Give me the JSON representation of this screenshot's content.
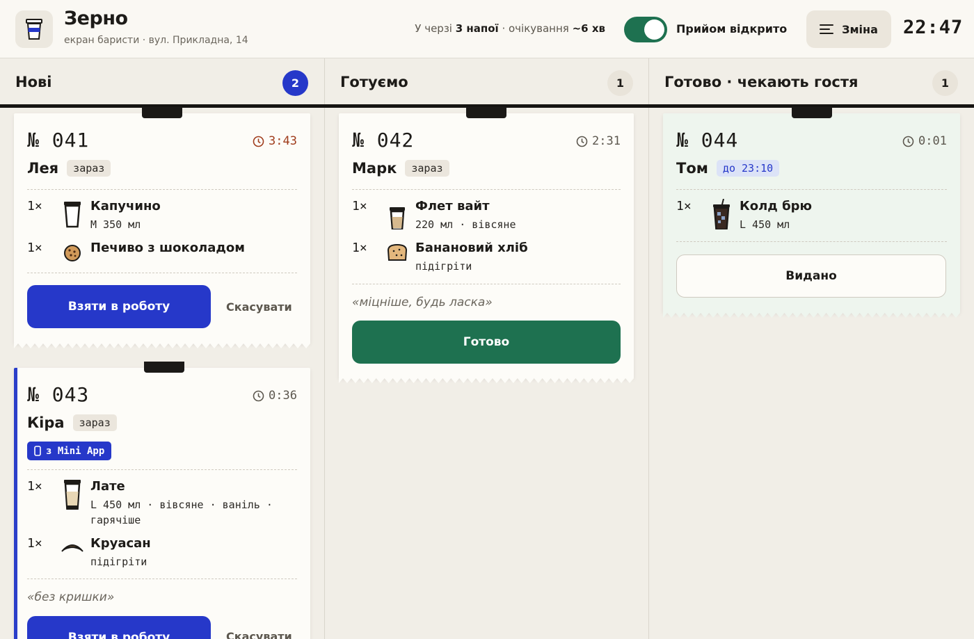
{
  "header": {
    "brand": "Зерно",
    "subtitle": "екран баристи · вул. Прикладна, 14",
    "queue_prefix": "У черзі ",
    "queue_count": "3 напої",
    "queue_mid": " · очікування ",
    "queue_wait": "~6 хв",
    "toggle_label": "Прийом відкрито",
    "toggle_on": true,
    "shift_label": "Зміна",
    "clock": "22:47"
  },
  "colors": {
    "accent": "#2638c9",
    "ready": "#1e7150",
    "warn": "#a03d1d",
    "ink": "#161412"
  },
  "columns": [
    {
      "title": "Нові",
      "count": "2"
    },
    {
      "title": "Готуємо",
      "count": "1"
    },
    {
      "title": "Готово · чекають гостя",
      "count": "1"
    }
  ],
  "tickets": {
    "t041": {
      "number": "№ 041",
      "timer": "3:43",
      "customer": "Лея",
      "chip": "зараз",
      "items": [
        {
          "qty": "1×",
          "icon": "cup-icon",
          "name": "Капучино",
          "opts": "M 350 мл"
        },
        {
          "qty": "1×",
          "icon": "cookie-icon",
          "name": "Печиво з шоколадом",
          "opts": ""
        }
      ],
      "primary": "Взяти в роботу",
      "cancel": "Скасувати"
    },
    "t043": {
      "number": "№ 043",
      "timer": "0:36",
      "customer": "Кіра",
      "chip": "зараз",
      "source": "з Mini App",
      "items": [
        {
          "qty": "1×",
          "icon": "tall-cup-icon",
          "name": "Лате",
          "opts": "L 450 мл · вівсяне · ваніль · гарячіше"
        },
        {
          "qty": "1×",
          "icon": "croissant-icon",
          "name": "Круасан",
          "opts": "підігріти"
        }
      ],
      "note": "«без кришки»",
      "primary": "Взяти в роботу",
      "cancel": "Скасувати"
    },
    "t042": {
      "number": "№ 042",
      "timer": "2:31",
      "customer": "Марк",
      "chip": "зараз",
      "items": [
        {
          "qty": "1×",
          "icon": "cup-icon",
          "name": "Флет вайт",
          "opts": "220 мл · вівсяне"
        },
        {
          "qty": "1×",
          "icon": "bread-icon",
          "name": "Банановий хліб",
          "opts": "підігріти"
        }
      ],
      "note": "«міцніше, будь ласка»",
      "primary": "Готово"
    },
    "t044": {
      "number": "№ 044",
      "timer": "0:01",
      "customer": "Том",
      "chip": "до 23:10",
      "items": [
        {
          "qty": "1×",
          "icon": "iced-drink-icon",
          "name": "Колд брю",
          "opts": "L 450 мл"
        }
      ],
      "primary": "Видано"
    }
  }
}
